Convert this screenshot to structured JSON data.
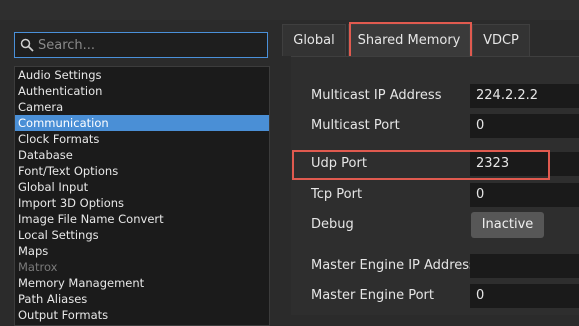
{
  "search": {
    "placeholder": "Search..."
  },
  "categories": [
    {
      "label": "Audio Settings"
    },
    {
      "label": "Authentication"
    },
    {
      "label": "Camera"
    },
    {
      "label": "Communication",
      "selected": true
    },
    {
      "label": "Clock Formats"
    },
    {
      "label": "Database"
    },
    {
      "label": "Font/Text Options"
    },
    {
      "label": "Global Input"
    },
    {
      "label": "Import 3D Options"
    },
    {
      "label": "Image File Name Convert"
    },
    {
      "label": "Local Settings"
    },
    {
      "label": "Maps"
    },
    {
      "label": "Matrox",
      "disabled": true
    },
    {
      "label": "Memory Management"
    },
    {
      "label": "Path Aliases"
    },
    {
      "label": "Output Formats"
    }
  ],
  "tabs": {
    "global": "Global",
    "shared_memory": "Shared Memory",
    "vdcp": "VDCP"
  },
  "fields": {
    "multicast_ip": {
      "label": "Multicast IP Address",
      "value": "224.2.2.2"
    },
    "multicast_port": {
      "label": "Multicast Port",
      "value": "0"
    },
    "udp_port": {
      "label": "Udp Port",
      "value": "2323"
    },
    "tcp_port": {
      "label": "Tcp Port",
      "value": "0"
    },
    "debug": {
      "label": "Debug",
      "value": "Inactive"
    },
    "master_engine_ip": {
      "label": "Master Engine IP Address",
      "value": ""
    },
    "master_engine_port": {
      "label": "Master Engine Port",
      "value": "0"
    }
  },
  "colors": {
    "selection": "#4a8fd6",
    "highlight": "#e05a4f",
    "focus_border": "#4a90d9"
  }
}
